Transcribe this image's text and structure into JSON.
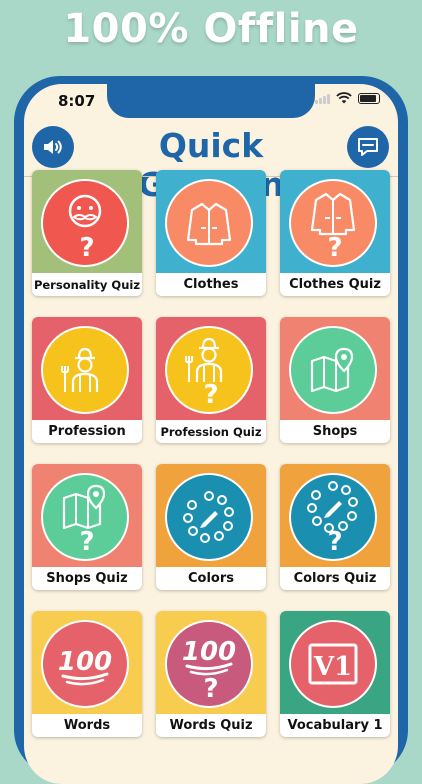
{
  "banner": "100% Offline",
  "status": {
    "time": "8:07"
  },
  "header": {
    "title": "Quick German",
    "sound_icon": "speaker-icon",
    "chat_icon": "chat-bubble-icon"
  },
  "colors": {
    "brand": "#1e66a8",
    "background": "#fbf3df",
    "page": "#a9d8c8"
  },
  "tiles": [
    {
      "label": "Personality Quiz",
      "bg": "#a2c07a",
      "circle": "#f0584f",
      "icon": "mustache-face-icon",
      "quiz": true
    },
    {
      "label": "Clothes",
      "bg": "#3fb1cf",
      "circle": "#f88a66",
      "icon": "jacket-icon",
      "quiz": false
    },
    {
      "label": "Clothes Quiz",
      "bg": "#3fb1cf",
      "circle": "#f88a66",
      "icon": "jacket-icon",
      "quiz": true
    },
    {
      "label": "Profession",
      "bg": "#e5626a",
      "circle": "#f6c21c",
      "icon": "farmer-icon",
      "quiz": false
    },
    {
      "label": "Profession Quiz",
      "bg": "#e5626a",
      "circle": "#f6c21c",
      "icon": "farmer-icon",
      "quiz": true
    },
    {
      "label": "Shops",
      "bg": "#f08272",
      "circle": "#5ccd98",
      "icon": "map-icon",
      "quiz": false
    },
    {
      "label": "Shops Quiz",
      "bg": "#f08272",
      "circle": "#5ccd98",
      "icon": "map-icon",
      "quiz": true
    },
    {
      "label": "Colors",
      "bg": "#f0a23c",
      "circle": "#1a8fb0",
      "icon": "palette-icon",
      "quiz": false
    },
    {
      "label": "Colors Quiz",
      "bg": "#f0a23c",
      "circle": "#1a8fb0",
      "icon": "palette-icon",
      "quiz": true
    },
    {
      "label": "Words",
      "bg": "#f8cc4e",
      "circle": "#e5626a",
      "icon": "hundred-points-icon",
      "quiz": false
    },
    {
      "label": "Words Quiz",
      "bg": "#f8cc4e",
      "circle": "#c75a7d",
      "icon": "hundred-points-icon",
      "quiz": true
    },
    {
      "label": "Vocabulary 1",
      "bg": "#3aa582",
      "circle": "#e5626a",
      "icon": "vocabulary-card-icon",
      "quiz": false
    }
  ]
}
